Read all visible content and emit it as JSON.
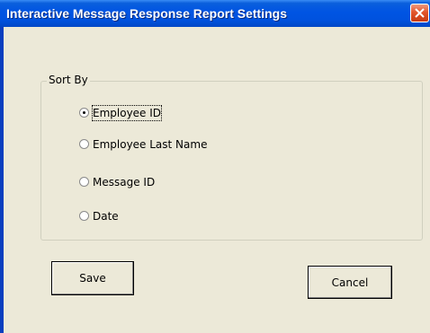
{
  "window": {
    "title": "Interactive Message Response Report Settings"
  },
  "sort_group": {
    "legend": "Sort By",
    "options": [
      {
        "label": "Employee ID",
        "checked": true
      },
      {
        "label": "Employee Last Name",
        "checked": false
      },
      {
        "label": "Message ID",
        "checked": false
      },
      {
        "label": "Date",
        "checked": false
      }
    ]
  },
  "buttons": {
    "save": "Save",
    "cancel": "Cancel"
  },
  "icons": {
    "close": "close-icon"
  },
  "colors": {
    "titlebar": "#0054e3",
    "close_button": "#e2562c",
    "dialog_background": "#ece9d8"
  }
}
